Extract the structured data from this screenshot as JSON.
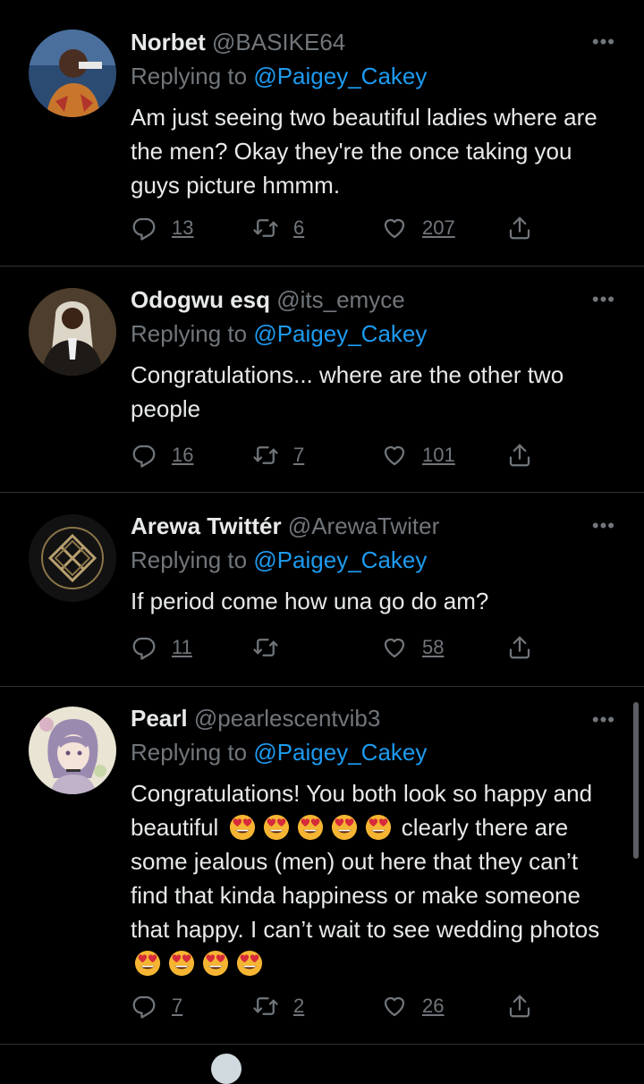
{
  "tweets": [
    {
      "name": "Norbet",
      "handle": "@BASIKE64",
      "reply_prefix": "Replying to",
      "reply_to": "@Paigey_Cakey",
      "text": "Am just seeing two beautiful ladies where are the men? Okay they're the once taking you guys picture hmmm.",
      "replies": "13",
      "retweets": "6",
      "likes": "207"
    },
    {
      "name": "Odogwu esq",
      "handle": "@its_emyce",
      "reply_prefix": "Replying to",
      "reply_to": "@Paigey_Cakey",
      "text": "Congratulations... where are the other two people",
      "replies": "16",
      "retweets": "7",
      "likes": "101"
    },
    {
      "name": "Arewa Twittér",
      "handle": "@ArewaTwiter",
      "reply_prefix": "Replying to",
      "reply_to": "@Paigey_Cakey",
      "text": "If period come how una go do am?",
      "replies": "11",
      "retweets": "",
      "likes": "58"
    },
    {
      "name": "Pearl",
      "handle": "@pearlescentvib3",
      "reply_prefix": "Replying to",
      "reply_to": "@Paigey_Cakey",
      "text_part1": "Congratulations! You both look so happy and beautiful",
      "text_part2": "clearly there are some jealous (men) out here that they can’t find that kinda happiness or make someone that happy. I can’t wait to see wedding photos",
      "replies": "7",
      "retweets": "2",
      "likes": "26"
    }
  ],
  "more_glyph": "•••",
  "colors": {
    "background": "#000000",
    "link": "#1d9bf0",
    "muted": "#71767b",
    "divider": "#2f3336"
  }
}
